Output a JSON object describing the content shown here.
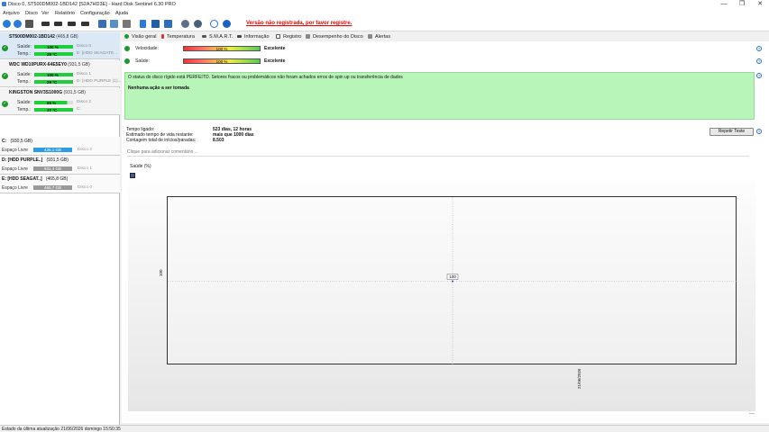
{
  "window": {
    "title": "Disco 0, ST500DM002-1BD142 [S2A7HD3E] - Hard Disk Sentinel 6.30 PRO",
    "minimize": "—",
    "maximize": "❐",
    "close": "✕"
  },
  "menu": [
    "Arquivo",
    "Disco",
    "Ver",
    "Relatório",
    "Configuração",
    "Ajuda"
  ],
  "toolbar": {
    "registration_notice": "Versão não registrada, por favor registre."
  },
  "disks": [
    {
      "name": "ST500DM002-1BD142",
      "size": "(465,8 GB)",
      "health_label": "Saúde:",
      "health_value": "100 %",
      "health_pct": 100,
      "health_ext": "Disco 0",
      "temp_label": "Temp.:",
      "temp_value": "29 °C",
      "temp_ext": "E: [HDD SEAGATE..."
    },
    {
      "name": "WDC WD10PURX-64E5EY0",
      "size": "(931,5 GB)",
      "health_label": "Saúde:",
      "health_value": "100 %",
      "health_pct": 100,
      "health_ext": "Disco 1",
      "temp_label": "Temp.:",
      "temp_value": "29 °C",
      "temp_ext": "D: [HDD PURPLE (1)..."
    },
    {
      "name": "KINGSTON SNV3S1000G",
      "size": "(931,5 GB)",
      "health_label": "Saúde:",
      "health_value": "85 %",
      "health_pct": 85,
      "health_ext": "Disco 2",
      "temp_label": "Temp.:",
      "temp_value": "37 °C",
      "temp_ext": "C:"
    }
  ],
  "partitions": [
    {
      "name": "C:",
      "size": "(930,5 GB)",
      "free_label": "Espaço Livre",
      "free_value": "436,1 GB",
      "free_ext": "Disco 2",
      "blue": true
    },
    {
      "name": "D: [HDD PURPLE..]",
      "size": "(931,5 GB)",
      "free_label": "Espaço Livre",
      "free_value": "931,4 GB",
      "free_ext": "Disco 1",
      "blue": false
    },
    {
      "name": "E: [HDD SEAGAT..]",
      "size": "(465,8 GB)",
      "free_label": "Espaço Livre",
      "free_value": "465,7 GB",
      "free_ext": "Disco 0",
      "blue": false
    }
  ],
  "tabs": [
    "Visão geral",
    "Temperatura",
    "S.M.A.R.T.",
    "Informação",
    "Registro",
    "Desempenho do Disco",
    "Alertas"
  ],
  "overview": {
    "speed_label": "Velocidade:",
    "speed_value": "100 %",
    "speed_pct": 100,
    "speed_status": "Excelente",
    "health_label": "Saúde:",
    "health_value": "100 %",
    "health_pct": 100,
    "health_status": "Excelente",
    "status_text": "O status do disco rígido está PERFEITO. Setores fracos ou problemáticos não foram achados erros de spin up ou transferência de dados",
    "action_text": "Nenhuma ação a ser tomada",
    "uptime_label": "Tempo ligado:",
    "uptime_value": "523 dias, 12 horas",
    "lifetime_label": "Estimado tempo de vida restante:",
    "lifetime_value": "mais que 1000 dias",
    "startstop_label": "Contagem total de inícios/paradas:",
    "startstop_value": "8.503",
    "repeat_button": "Repetir Teste",
    "comment_placeholder": "Clique para adicionar comentário ...",
    "chart_label": "Saúde (%)"
  },
  "chart_data": {
    "type": "line",
    "title": "Saúde (%)",
    "x": [
      "21/06/2026"
    ],
    "series": [
      {
        "values": [
          100
        ]
      }
    ],
    "ylim": [
      0,
      200
    ],
    "point_label": "100",
    "y_tick": "100",
    "grid": true
  },
  "statusbar": {
    "text": "Estado da última atualização 21/06/2026 domingo 15:50:35"
  },
  "colors": {
    "ok": "#1a9a2a",
    "health_bar": "#1fcf3a",
    "status_bg": "#b8f5b8",
    "warning": "#e00000",
    "partition_blue": "#2e9be6"
  }
}
